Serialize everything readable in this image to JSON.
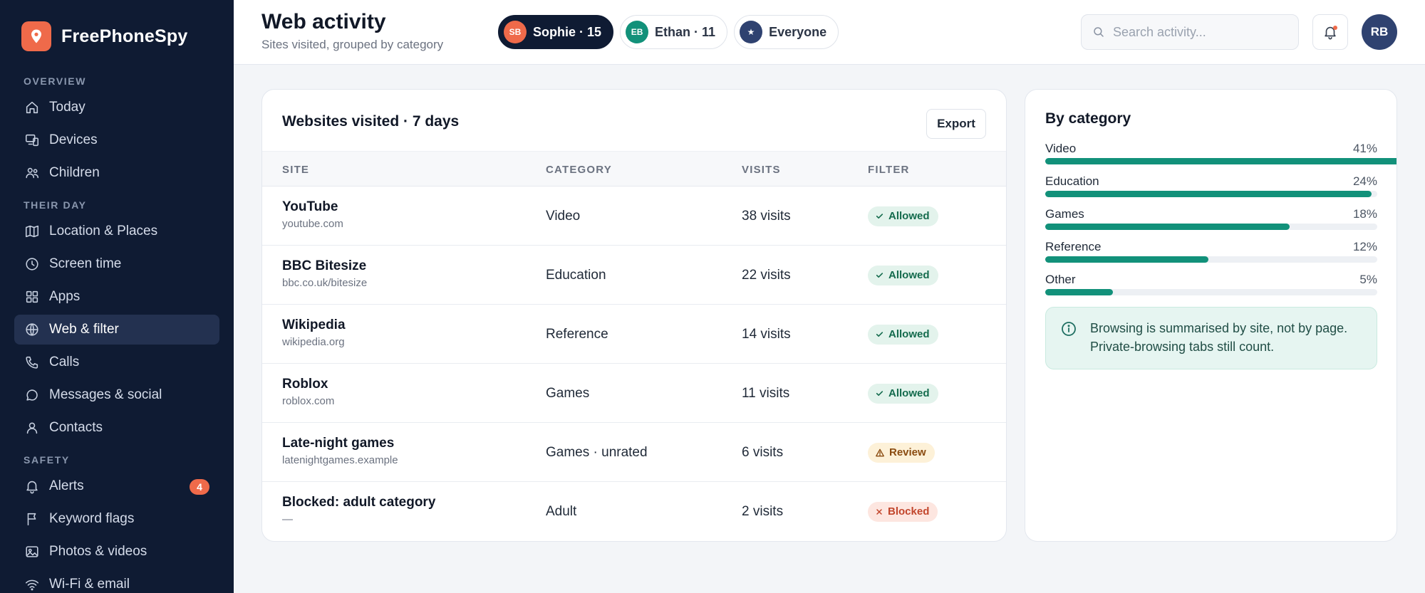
{
  "brand": {
    "name": "FreePhoneSpy"
  },
  "sidebar": {
    "sections": [
      {
        "title": "OVERVIEW",
        "items": [
          {
            "label": "Today",
            "icon": "home-icon"
          },
          {
            "label": "Devices",
            "icon": "devices-icon"
          },
          {
            "label": "Children",
            "icon": "children-icon"
          }
        ]
      },
      {
        "title": "THEIR DAY",
        "items": [
          {
            "label": "Location & Places",
            "icon": "map-icon"
          },
          {
            "label": "Screen time",
            "icon": "clock-icon"
          },
          {
            "label": "Apps",
            "icon": "apps-grid-icon"
          },
          {
            "label": "Web & filter",
            "icon": "globe-icon",
            "active": true
          },
          {
            "label": "Calls",
            "icon": "phone-icon"
          },
          {
            "label": "Messages & social",
            "icon": "chat-bubble-icon"
          },
          {
            "label": "Contacts",
            "icon": "person-icon"
          }
        ]
      },
      {
        "title": "SAFETY",
        "items": [
          {
            "label": "Alerts",
            "icon": "bell-icon",
            "badge": "4"
          },
          {
            "label": "Keyword flags",
            "icon": "flag-icon"
          },
          {
            "label": "Photos & videos",
            "icon": "image-icon"
          },
          {
            "label": "Wi-Fi & email",
            "icon": "wifi-icon"
          }
        ]
      }
    ]
  },
  "header": {
    "title": "Web activity",
    "subtitle": "Sites visited, grouped by category",
    "children": [
      {
        "initials": "SB",
        "label": "Sophie · 15",
        "avatar_color": "#ef6a4a",
        "active": true
      },
      {
        "initials": "EB",
        "label": "Ethan · 11",
        "avatar_color": "#12917a",
        "active": false
      },
      {
        "initials": "★",
        "label": "Everyone",
        "avatar_color": "#2f4270",
        "active": false
      }
    ],
    "search_placeholder": "Search activity...",
    "user_initials": "RB"
  },
  "sites": {
    "title": "Websites visited · 7 days",
    "export_label": "Export",
    "columns": [
      "SITE",
      "CATEGORY",
      "VISITS",
      "FILTER"
    ],
    "rows": [
      {
        "name": "YouTube",
        "domain": "youtube.com",
        "category": "Video",
        "visits": "38 visits",
        "status": "Allowed",
        "kind": "allowed"
      },
      {
        "name": "BBC Bitesize",
        "domain": "bbc.co.uk/bitesize",
        "category": "Education",
        "visits": "22 visits",
        "status": "Allowed",
        "kind": "allowed"
      },
      {
        "name": "Wikipedia",
        "domain": "wikipedia.org",
        "category": "Reference",
        "visits": "14 visits",
        "status": "Allowed",
        "kind": "allowed"
      },
      {
        "name": "Roblox",
        "domain": "roblox.com",
        "category": "Games",
        "visits": "11 visits",
        "status": "Allowed",
        "kind": "allowed"
      },
      {
        "name": "Late-night games",
        "domain": "latenightgames.example",
        "category": "Games · unrated",
        "visits": "6 visits",
        "status": "Review",
        "kind": "review"
      },
      {
        "name": "Blocked: adult category",
        "domain": "—",
        "category": "Adult",
        "visits": "2 visits",
        "status": "Blocked",
        "kind": "blocked"
      }
    ]
  },
  "categories": {
    "title": "By category",
    "items": [
      {
        "label": "Video",
        "percent": 41,
        "display": "41%"
      },
      {
        "label": "Education",
        "percent": 24,
        "display": "24%"
      },
      {
        "label": "Games",
        "percent": 18,
        "display": "18%"
      },
      {
        "label": "Reference",
        "percent": 12,
        "display": "12%"
      },
      {
        "label": "Other",
        "percent": 5,
        "display": "5%"
      }
    ],
    "info_text": "Browsing is summarised by site, not by page. Private-browsing tabs still count."
  },
  "colors": {
    "sidebar_bg": "#0f1b33",
    "accent": "#ef6a4a",
    "category_bar": "#12917a"
  }
}
